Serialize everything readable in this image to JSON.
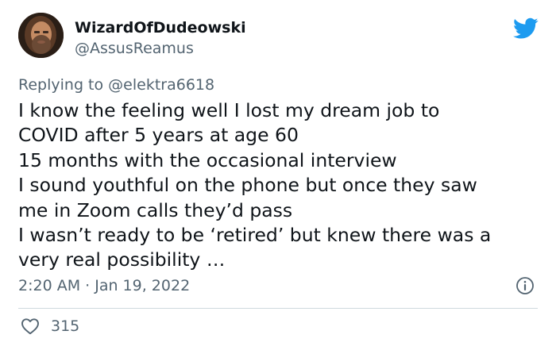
{
  "author": {
    "display_name": "WizardOfDudeowski",
    "handle": "@AssusReamus"
  },
  "reply": {
    "prefix": "Replying to",
    "mention": "@elektra6618"
  },
  "tweet": {
    "text": "I know the feeling well I lost my dream job to\nCOVID after 5 years at age 60\n15 months with the occasional interview\nI sound youthful on the phone but once they saw\nme in Zoom calls they’d pass\nI wasn’t ready to be ‘retired’ but knew there was a\nvery real possibility …",
    "timestamp": "2:20 AM · Jan 19, 2022",
    "likes": "315"
  },
  "icons": {
    "brand": "twitter-bird-icon",
    "info": "info-icon",
    "like": "heart-icon"
  },
  "colors": {
    "brand": "#1d9bf0",
    "secondary_text": "#536471",
    "primary_text": "#0f1419",
    "divider": "#cfd9de"
  }
}
